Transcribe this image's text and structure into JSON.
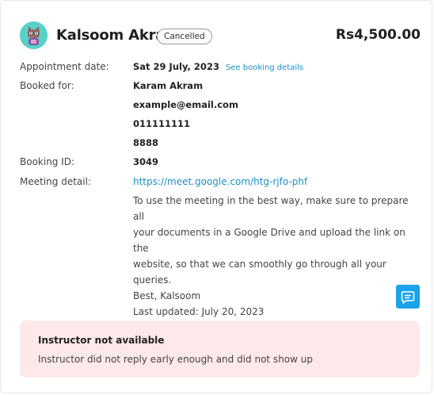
{
  "header": {
    "name": "Kalsoom Akram",
    "status": "Cancelled",
    "price": "Rs4,500.00"
  },
  "details": {
    "appointment_label": "Appointment date:",
    "appointment_date": "Sat 29 July, 2023",
    "see_details_link": "See booking details",
    "booked_for_label": "Booked for:",
    "booked_for_name": "Karam Akram",
    "booked_for_email": "example@email.com",
    "booked_for_phone": "011111111",
    "booked_for_extra": "8888",
    "booking_id_label": "Booking ID:",
    "booking_id": "3049",
    "meeting_label": "Meeting detail:",
    "meeting_link": "https://meet.google.com/htg-rjfo-phf",
    "meeting_note_lines": [
      "To use the meeting in the best way, make sure to prepare all",
      "your documents in a Google Drive and upload the link on the",
      "website, so that we can smoothly go through all your queries.",
      "Best, Kalsoom"
    ],
    "last_updated": "Last updated: July 20, 2023"
  },
  "alert": {
    "title": "Instructor not available",
    "message": "Instructor did not reply early enough and did not show up"
  },
  "icons": {
    "chat": "chat-bubble-icon",
    "avatar": "cat-avatar"
  },
  "colors": {
    "accent": "#1aa3e8",
    "link": "#1e90c8",
    "avatar_bg": "#5ad1c7",
    "alert_bg": "#fde9e9"
  }
}
